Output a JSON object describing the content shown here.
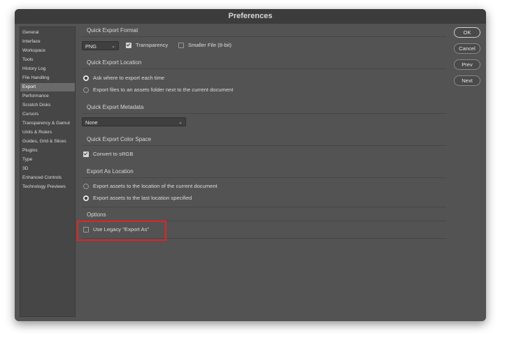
{
  "window": {
    "title": "Preferences"
  },
  "sidebar": {
    "items": [
      {
        "label": "General"
      },
      {
        "label": "Interface"
      },
      {
        "label": "Workspace"
      },
      {
        "label": "Tools"
      },
      {
        "label": "History Log"
      },
      {
        "label": "File Handling"
      },
      {
        "label": "Export",
        "selected": true
      },
      {
        "label": "Performance"
      },
      {
        "label": "Scratch Disks"
      },
      {
        "label": "Cursors"
      },
      {
        "label": "Transparency & Gamut"
      },
      {
        "label": "Units & Rulers"
      },
      {
        "label": "Guides, Grid & Slices"
      },
      {
        "label": "Plugins"
      },
      {
        "label": "Type"
      },
      {
        "label": "3D"
      },
      {
        "label": "Enhanced Controls"
      },
      {
        "label": "Technology Previews"
      }
    ]
  },
  "quick_export_format": {
    "title": "Quick Export Format",
    "format_value": "PNG",
    "transparency_label": "Transparency",
    "transparency_checked": true,
    "smaller_file_label": "Smaller File (8-bit)",
    "smaller_file_checked": false
  },
  "quick_export_location": {
    "title": "Quick Export Location",
    "option_ask": "Ask where to export each time",
    "option_assets": "Export files to an assets folder next to the current document",
    "selected": "ask"
  },
  "quick_export_metadata": {
    "title": "Quick Export Metadata",
    "value": "None"
  },
  "quick_export_color_space": {
    "title": "Quick Export Color Space",
    "convert_label": "Convert to sRGB",
    "convert_checked": true
  },
  "export_as_location": {
    "title": "Export As Location",
    "option_current": "Export assets to the location of the current document",
    "option_last": "Export assets to the last location specified",
    "selected": "last"
  },
  "options": {
    "title": "Options",
    "legacy_label": "Use Legacy \"Export As\"",
    "legacy_checked": false,
    "highlight_color": "#e12424"
  },
  "buttons": {
    "ok": "OK",
    "cancel": "Cancel",
    "prev": "Prev",
    "next": "Next"
  }
}
